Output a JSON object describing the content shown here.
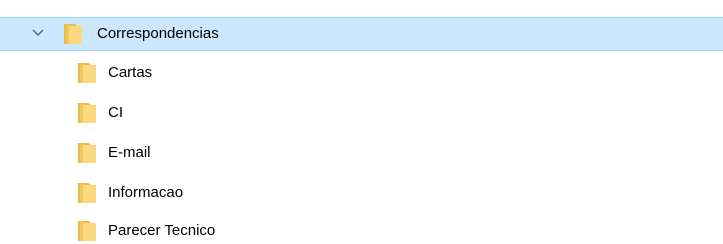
{
  "tree": {
    "root": {
      "label": "Correspondencias",
      "expanded": true,
      "selected": true,
      "icon": "folder-icon",
      "expander_icon": "chevron-down-icon"
    },
    "children": [
      {
        "label": "Cartas",
        "icon": "folder-icon"
      },
      {
        "label": "CI",
        "icon": "folder-icon"
      },
      {
        "label": "E-mail",
        "icon": "folder-icon"
      },
      {
        "label": "Informacao",
        "icon": "folder-icon"
      },
      {
        "label": "Parecer Tecnico",
        "icon": "folder-icon"
      }
    ]
  },
  "colors": {
    "selection_bg": "#cce8ff",
    "selection_border": "#99d1ff",
    "folder_body": "#fbd981",
    "folder_tab": "#e8bb4a"
  }
}
